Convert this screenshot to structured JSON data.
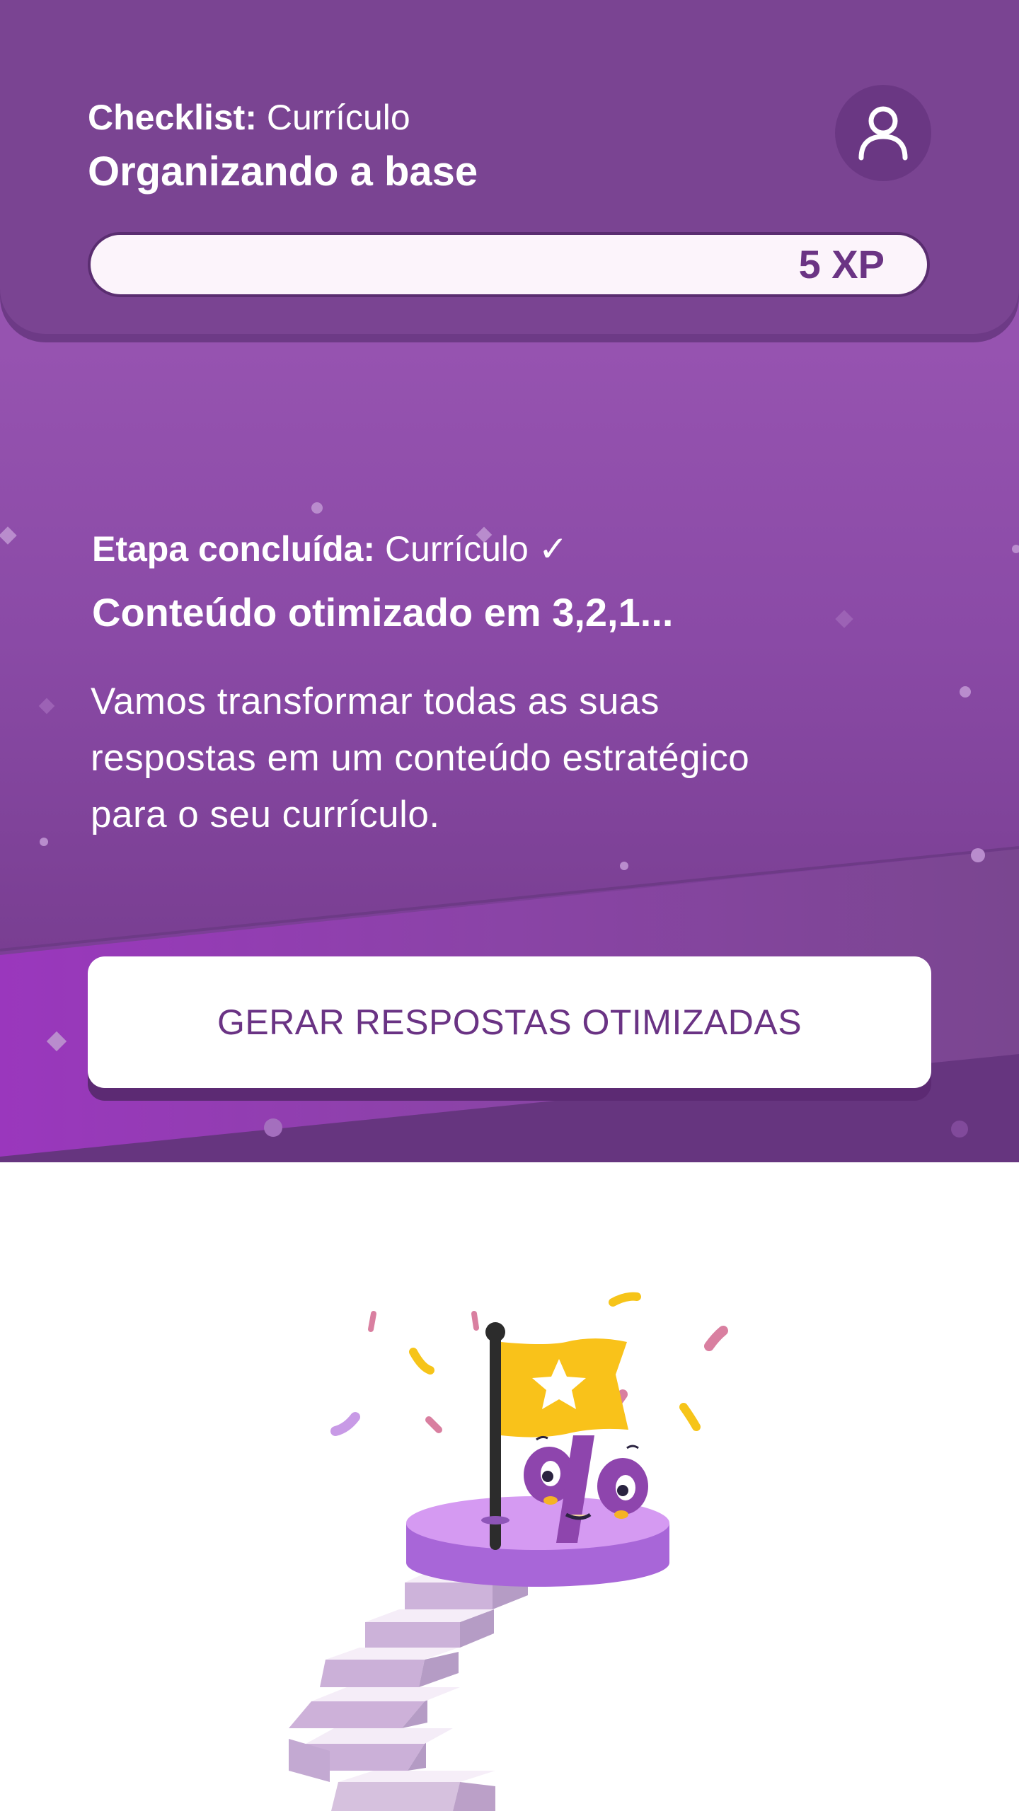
{
  "header": {
    "checklist_label": "Checklist:",
    "checklist_value": "Currículo",
    "title": "Organizando a base",
    "xp_label": "5 XP",
    "progress_fraction": 0.0,
    "avatar_icon": "user-icon"
  },
  "stage": {
    "label": "Etapa concluída:",
    "value": "Currículo ✓",
    "title": "Conteúdo otimizado em 3,2,1...",
    "description": "Vamos transformar todas as suas respostas em um conteúdo estratégico para o seu currículo."
  },
  "cta": {
    "label": "GERAR RESPOSTAS OTIMIZADAS"
  },
  "illustration": {
    "icon": "podium-flag-percent-mascot",
    "flag_icon": "star-icon"
  },
  "colors": {
    "header_bg": "#7a4492",
    "hero_bg": "#9653b0",
    "accent_purple": "#6a3384",
    "flag_yellow": "#f9c21a",
    "podium_purple": "#b06fe0"
  }
}
